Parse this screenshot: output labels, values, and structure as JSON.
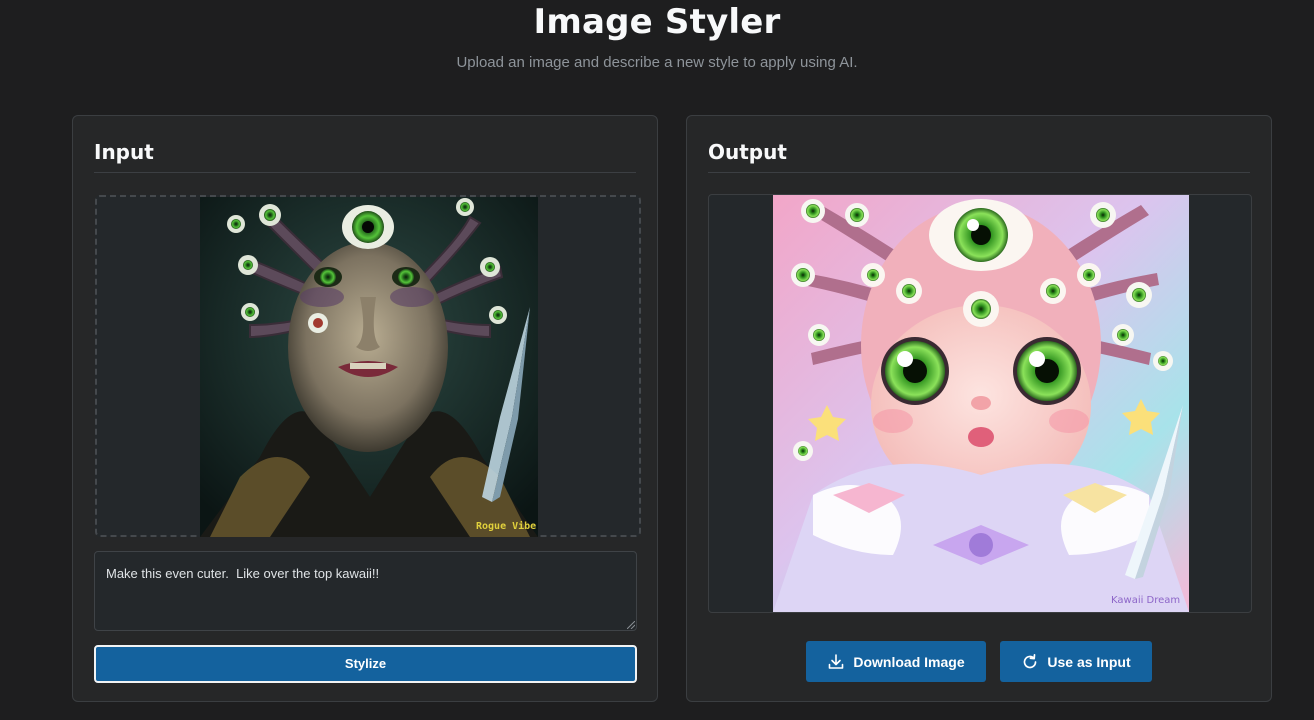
{
  "header": {
    "title": "Image Styler",
    "subtitle": "Upload an image and describe a new style to apply using AI."
  },
  "input_panel": {
    "heading": "Input",
    "image": {
      "description": "dark fantasy portrait with third eye",
      "watermark": "Rogue Vibe"
    },
    "prompt_value": "Make this even cuter.  Like over the top kawaii!!",
    "stylize_label": "Stylize"
  },
  "output_panel": {
    "heading": "Output",
    "image": {
      "description": "pastel kawaii version of the portrait",
      "watermark": "Kawaii Dream"
    },
    "download_label": "Download Image",
    "use_as_input_label": "Use as Input"
  },
  "colors": {
    "background": "#1e1e1f",
    "card": "#262728",
    "accent_button": "#14629e"
  }
}
